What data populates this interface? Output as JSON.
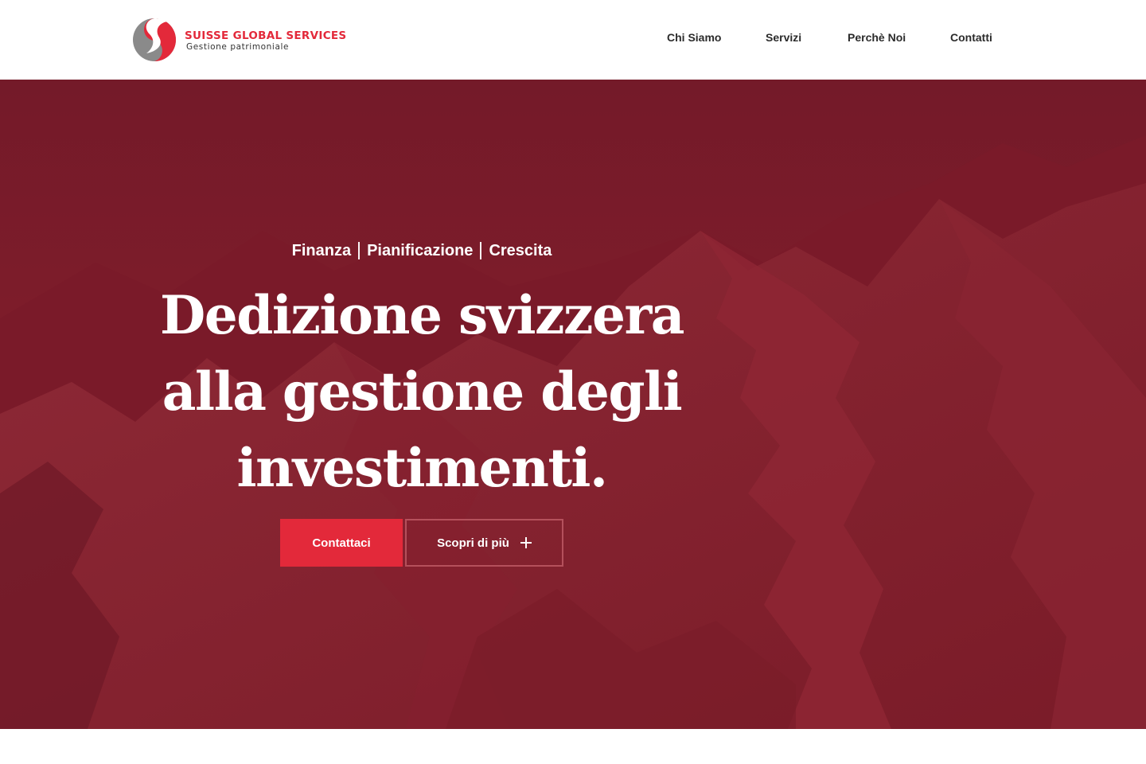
{
  "brand": {
    "name": "SUISSE GLOBAL SERVICES",
    "tagline": "Gestione patrimoniale",
    "colors": {
      "red": "#e3293a",
      "gray": "#8a8a8a"
    }
  },
  "nav": {
    "items": [
      {
        "label": "Chi Siamo"
      },
      {
        "label": "Servizi"
      },
      {
        "label": "Perchè Noi"
      },
      {
        "label": "Contatti"
      }
    ]
  },
  "hero": {
    "tagline": [
      "Finanza",
      "Pianificazione",
      "Crescita"
    ],
    "headline": [
      "Dedizione svizzera",
      "alla gestione degli",
      "investimenti."
    ],
    "primary_button": "Contattaci",
    "secondary_button": "Scopri di più",
    "secondary_icon": "plus-icon",
    "overlay_color": "#7e1c2a"
  }
}
